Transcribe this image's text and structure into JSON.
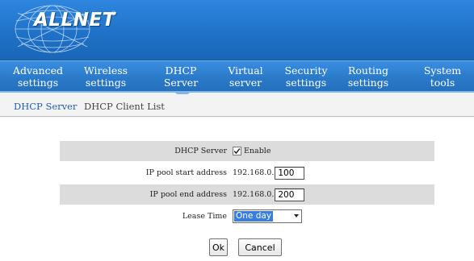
{
  "brand": {
    "name": "ALLNET",
    "registered_mark": "®"
  },
  "nav": {
    "items": [
      {
        "label": "Advanced\nsettings",
        "active": false
      },
      {
        "label": "Wireless\nsettings",
        "active": false
      },
      {
        "label": "DHCP\nServer",
        "active": true
      },
      {
        "label": "Virtual\nserver",
        "active": false
      },
      {
        "label": "Security\nsettings",
        "active": false
      },
      {
        "label": "Routing\nsettings",
        "active": false
      },
      {
        "label": "System\ntools",
        "active": false
      }
    ]
  },
  "subnav": {
    "dhcp_server": "DHCP Server",
    "dhcp_client_list": "DHCP Client List"
  },
  "form": {
    "dhcp_server": {
      "label": "DHCP Server",
      "checkbox_label": "Enable",
      "checked": true
    },
    "pool_start": {
      "label": "IP pool start address",
      "prefix": "192.168.0.",
      "value": "100"
    },
    "pool_end": {
      "label": "IP pool end address",
      "prefix": "192.168.0.",
      "value": "200"
    },
    "lease_time": {
      "label": "Lease Time",
      "selected": "One day"
    }
  },
  "buttons": {
    "ok": "Ok",
    "cancel": "Cancel"
  },
  "colors": {
    "banner": "#1f72c8",
    "nav": "#2a79c8",
    "active_link": "#1f5fae",
    "row_shade": "#dcdcdc",
    "select_highlight": "#3a7de0"
  }
}
